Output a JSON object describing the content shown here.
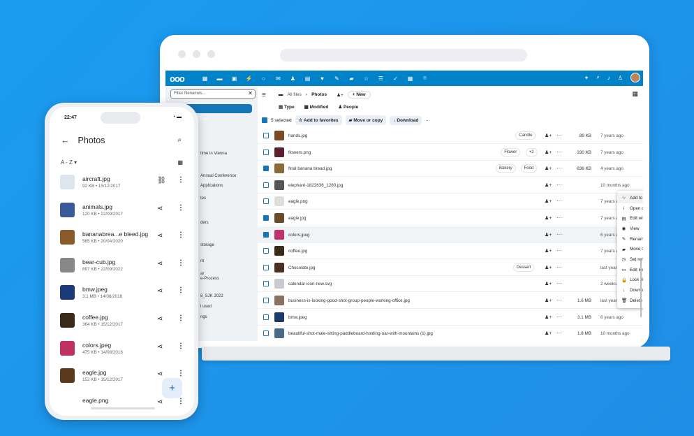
{
  "laptop": {
    "filter_placeholder": "Filter filenames...",
    "breadcrumb": {
      "all_files": "All files",
      "current": "Photos",
      "new_label": "+ New"
    },
    "filters": {
      "type": "Type",
      "modified": "Modified",
      "people": "People"
    },
    "action_bar": {
      "selected": "5 selected",
      "add_fav": "Add to favorites",
      "move": "Move or copy",
      "download": "Download"
    },
    "nav_partial": [
      "Files",
      "time in Vienna",
      "Annual Conference",
      "Applications",
      "tes",
      "ders",
      "storage",
      "nt",
      "ar",
      "e-Prozess",
      "8_SJK 2022",
      "l used",
      "ngs"
    ],
    "files": [
      {
        "name": "hands.jpg",
        "tags": [
          "Candle"
        ],
        "size": "89 KB",
        "date": "7 years ago",
        "checked": false,
        "color": "#7a4a22"
      },
      {
        "name": "flowers.png",
        "tags": [
          "Flower",
          "+2"
        ],
        "size": "330 KB",
        "date": "7 years ago",
        "checked": false,
        "color": "#5a2030"
      },
      {
        "name": "final banana bread.jpg",
        "tags": [
          "Bakery",
          "Food"
        ],
        "size": "836 KB",
        "date": "4 years ago",
        "checked": true,
        "color": "#8a6a3a"
      },
      {
        "name": "elephant-1822636_1280.jpg",
        "tags": [],
        "size": "",
        "date": "10 months ago",
        "checked": false,
        "color": "#555"
      },
      {
        "name": "eagle.png",
        "tags": [],
        "size": "",
        "date": "7 years ago",
        "checked": false,
        "color": "#ddd"
      },
      {
        "name": "eagle.jpg",
        "tags": [],
        "size": "",
        "date": "7 years ago",
        "checked": true,
        "color": "#6a4a2a"
      },
      {
        "name": "colors.jpeg",
        "tags": [],
        "size": "",
        "date": "6 years ago",
        "checked": true,
        "color": "#c0306a"
      },
      {
        "name": "coffee.jpg",
        "tags": [],
        "size": "",
        "date": "7 years ago",
        "checked": false,
        "color": "#3a2a1a"
      },
      {
        "name": "Chocolate.jpg",
        "tags": [
          "Dessert"
        ],
        "size": "",
        "date": "last year",
        "checked": false,
        "color": "#4a3020"
      },
      {
        "name": "calendar icon-new.svg",
        "tags": [],
        "size": "",
        "date": "2 weeks ago",
        "checked": false,
        "color": "#c8ccd0"
      },
      {
        "name": "business-is-looking-good-shot-group-people-working-office.jpg",
        "tags": [],
        "size": "1.6 MB",
        "date": "last year",
        "checked": false,
        "color": "#8a7060"
      },
      {
        "name": "bmw.jpeg",
        "tags": [],
        "size": "3.1 MB",
        "date": "6 years ago",
        "checked": false,
        "color": "#1a3a6a"
      },
      {
        "name": "beautiful-shot-male-sitting-paddleboard-holding-oar-with-mountains (1).jpg",
        "tags": [],
        "size": "1.8 MB",
        "date": "10 months ago",
        "checked": false,
        "color": "#4a6a8a"
      }
    ],
    "context_menu": [
      {
        "icon": "☆",
        "label": "Add to favorites"
      },
      {
        "icon": "i",
        "label": "Open details"
      },
      {
        "icon": "▤",
        "label": "Edit with Nextcloud Office"
      },
      {
        "icon": "◉",
        "label": "View"
      },
      {
        "icon": "✎",
        "label": "Rename"
      },
      {
        "icon": "▰",
        "label": "Move or copy"
      },
      {
        "icon": "◷",
        "label": "Set reminder"
      },
      {
        "icon": "▭",
        "label": "Edit locally"
      },
      {
        "icon": "🔒",
        "label": "Lock file"
      },
      {
        "icon": "↓",
        "label": "Download"
      },
      {
        "icon": "🗑",
        "label": "Delete file"
      }
    ]
  },
  "phone": {
    "time": "22:47",
    "title": "Photos",
    "sort": "A - Z",
    "files": [
      {
        "name": "aircraft.jpg",
        "meta": "92 KB • 15/12/2017",
        "color": "#dde6ee",
        "action": "link"
      },
      {
        "name": "animals.jpg",
        "meta": "120 KB • 22/09/2017",
        "color": "#3a5a9a",
        "action": "share"
      },
      {
        "name": "bananabrea...e bleed.jpg",
        "meta": "565 KB • 20/04/2020",
        "color": "#8a5a2a",
        "action": "share"
      },
      {
        "name": "bear-cub.jpg",
        "meta": "697 KB • 22/09/2022",
        "color": "#888",
        "action": "share"
      },
      {
        "name": "bmw.jpeg",
        "meta": "3.1 MB • 14/08/2018",
        "color": "#1a3a7a",
        "action": "share"
      },
      {
        "name": "coffee.jpg",
        "meta": "364 KB • 15/12/2017",
        "color": "#3a2a1a",
        "action": "share"
      },
      {
        "name": "colors.jpeg",
        "meta": "475 KB • 14/08/2018",
        "color": "#c03060",
        "action": "share"
      },
      {
        "name": "eagle.jpg",
        "meta": "152 KB • 15/12/2017",
        "color": "#5a3a1a",
        "action": "share"
      },
      {
        "name": "eagle.png",
        "meta": "",
        "color": "#fff",
        "action": "share"
      }
    ]
  }
}
